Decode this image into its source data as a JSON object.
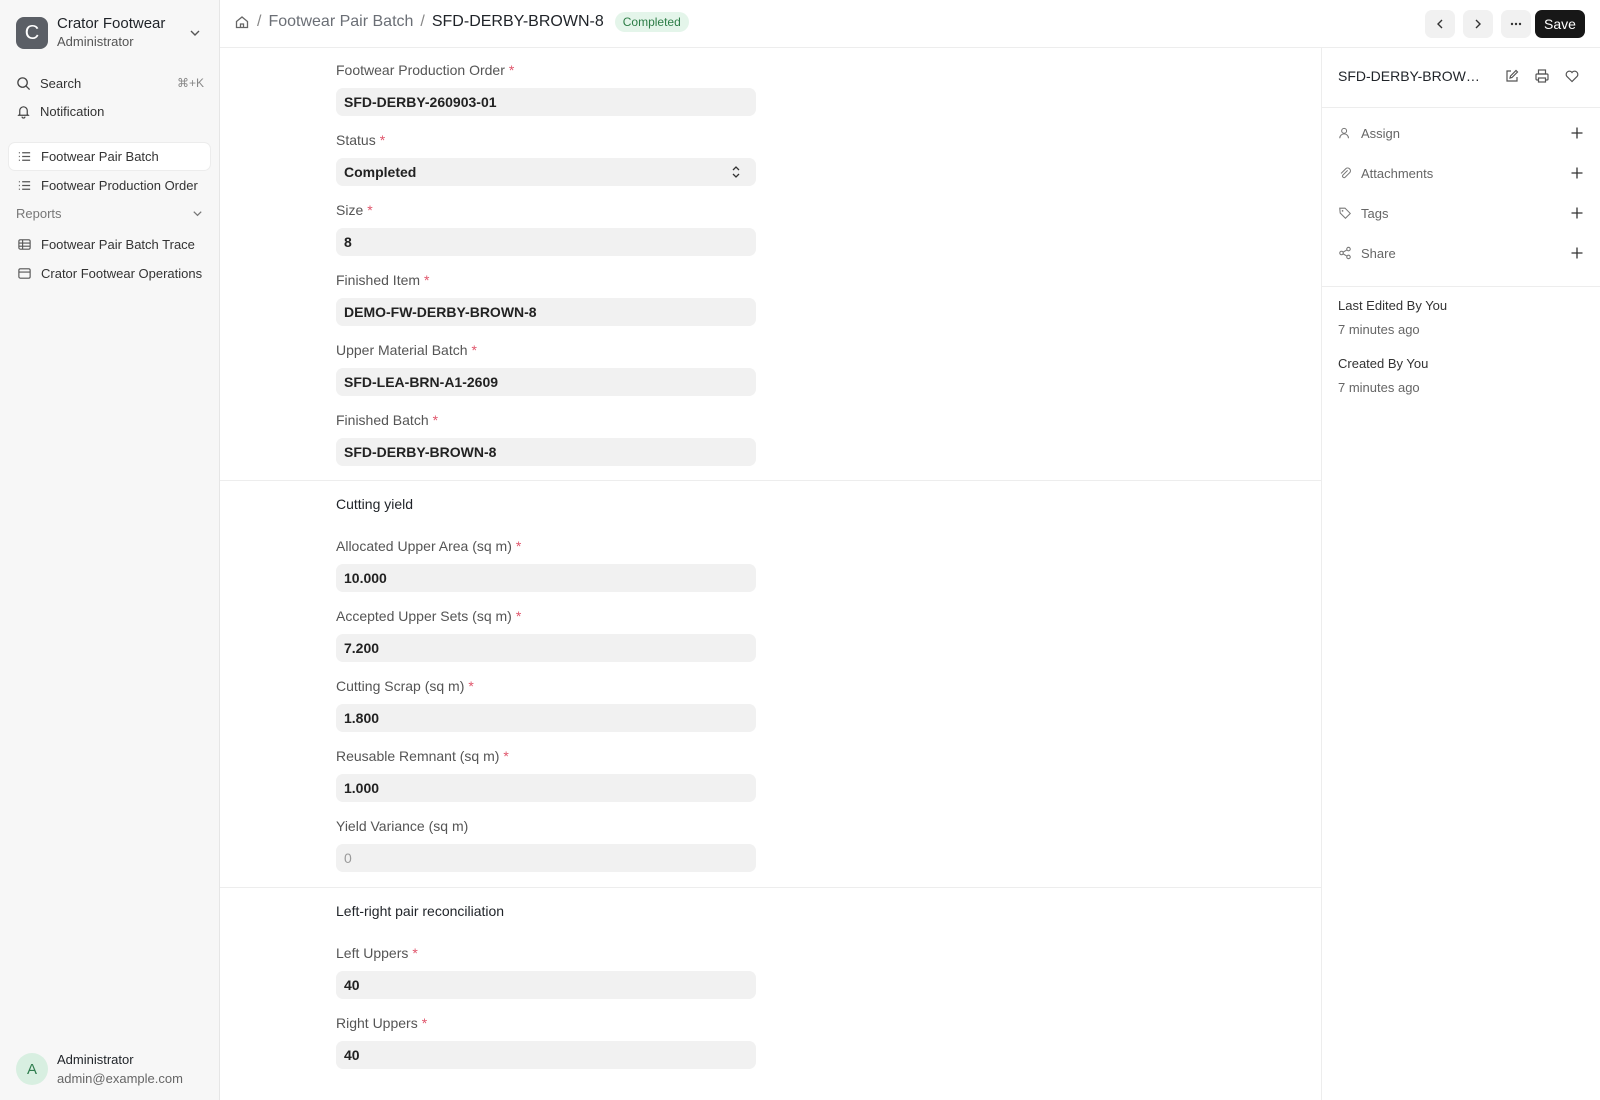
{
  "brand": {
    "initial": "C",
    "name": "Crator Footwear",
    "role": "Administrator"
  },
  "sidebar": {
    "search_label": "Search",
    "search_shortcut": "⌘+K",
    "notification_label": "Notification",
    "items": [
      {
        "label": "Footwear Pair Batch",
        "active": true
      },
      {
        "label": "Footwear Production Order",
        "active": false
      }
    ],
    "reports_label": "Reports",
    "reports": [
      {
        "label": "Footwear Pair Batch Trace"
      },
      {
        "label": "Crator Footwear Operations"
      }
    ]
  },
  "user": {
    "initial": "A",
    "name": "Administrator",
    "email": "admin@example.com"
  },
  "topbar": {
    "breadcrumb_doctype": "Footwear Pair Batch",
    "breadcrumb_doc": "SFD-DERBY-BROWN-8",
    "status_badge": "Completed",
    "save_label": "Save"
  },
  "form": {
    "fields": [
      {
        "label": "Footwear Production Order",
        "required": "*",
        "value": "SFD-DERBY-260903-01"
      },
      {
        "label": "Status",
        "required": "*",
        "value": "Completed"
      },
      {
        "label": "Size",
        "required": "*",
        "value": "8"
      },
      {
        "label": "Finished Item",
        "required": "*",
        "value": "DEMO-FW-DERBY-BROWN-8"
      },
      {
        "label": "Upper Material Batch",
        "required": "*",
        "value": "SFD-LEA-BRN-A1-2609"
      },
      {
        "label": "Finished Batch",
        "required": "*",
        "value": "SFD-DERBY-BROWN-8"
      }
    ],
    "section_cutting": {
      "title": "Cutting yield",
      "fields": [
        {
          "label": "Allocated Upper Area (sq m)",
          "required": "*",
          "value": "10.000"
        },
        {
          "label": "Accepted Upper Sets (sq m)",
          "required": "*",
          "value": "7.200"
        },
        {
          "label": "Cutting Scrap (sq m)",
          "required": "*",
          "value": "1.800"
        },
        {
          "label": "Reusable Remnant (sq m)",
          "required": "*",
          "value": "1.000"
        },
        {
          "label": "Yield Variance (sq m)",
          "required": "",
          "value": "0"
        }
      ]
    },
    "section_pairs": {
      "title": "Left-right pair reconciliation",
      "fields": [
        {
          "label": "Left Uppers",
          "required": "*",
          "value": "40"
        },
        {
          "label": "Right Uppers",
          "required": "*",
          "value": "40"
        }
      ]
    }
  },
  "panel": {
    "title": "SFD-DERBY-BROWN-8",
    "rows": [
      {
        "label": "Assign"
      },
      {
        "label": "Attachments"
      },
      {
        "label": "Tags"
      },
      {
        "label": "Share"
      }
    ],
    "last_edited": "Last Edited By You",
    "last_edited_time": "7 minutes ago",
    "created": "Created By You",
    "created_time": "7 minutes ago"
  }
}
